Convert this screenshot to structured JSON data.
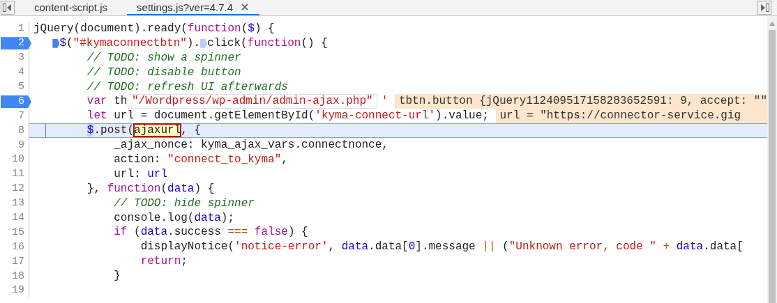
{
  "tabs": [
    {
      "label": "content-script.js",
      "selected": false
    },
    {
      "label": "settings.js?ver=4.7.4",
      "selected": true
    }
  ],
  "popover": {
    "kind": "string",
    "value": "\"/Wordpress/wp-admin/admin-ajax.php\""
  },
  "lines": [
    {
      "number": "1",
      "breakpoint": false,
      "current": false,
      "tokens": [
        {
          "kind": "plain",
          "text": "jQuery(document).ready("
        },
        {
          "kind": "keyword",
          "text": "function"
        },
        {
          "kind": "plain",
          "text": "("
        },
        {
          "kind": "variable",
          "text": "$"
        },
        {
          "kind": "plain",
          "text": ") {"
        }
      ]
    },
    {
      "number": "2",
      "breakpoint": true,
      "current": false,
      "tokens": [
        {
          "kind": "marker",
          "active": true
        },
        {
          "kind": "variable",
          "text": "$"
        },
        {
          "kind": "plain",
          "text": "("
        },
        {
          "kind": "string",
          "text": "\"#kymaconnectbtn\""
        },
        {
          "kind": "plain",
          "text": ")."
        },
        {
          "kind": "marker",
          "active": false
        },
        {
          "kind": "plain",
          "text": "click("
        },
        {
          "kind": "keyword",
          "text": "function"
        },
        {
          "kind": "plain",
          "text": "() {"
        }
      ]
    },
    {
      "number": "3",
      "breakpoint": false,
      "current": false,
      "tokens": [
        {
          "kind": "comment",
          "text": "        // TODO: show a spinner"
        }
      ]
    },
    {
      "number": "4",
      "breakpoint": false,
      "current": false,
      "tokens": [
        {
          "kind": "comment",
          "text": "        // TODO: disable button"
        }
      ]
    },
    {
      "number": "5",
      "breakpoint": false,
      "current": false,
      "tokens": [
        {
          "kind": "comment",
          "text": "        // TODO: refresh UI afterwards"
        }
      ]
    },
    {
      "number": "6",
      "breakpoint": true,
      "current": false,
      "tokens": [
        {
          "kind": "keyword",
          "text": "        var"
        },
        {
          "kind": "plain",
          "text": " th"
        }
      ],
      "after_popover": [
        {
          "kind": "string",
          "text": "'"
        }
      ],
      "inline_value": "tbtn.button {jQuery112409517158283652591: 9, accept: \"\""
    },
    {
      "number": "7",
      "breakpoint": false,
      "current": false,
      "tokens": [
        {
          "kind": "keyword",
          "text": "        let"
        },
        {
          "kind": "plain",
          "text": " url = document.getElementById("
        },
        {
          "kind": "string",
          "text": "'kyma-connect-url'"
        },
        {
          "kind": "plain",
          "text": ").value;"
        }
      ],
      "inline_value": "url = \"https://connector-service.gig"
    },
    {
      "number": "8",
      "breakpoint": false,
      "current": true,
      "tokens": [
        {
          "kind": "match",
          "text": "        $"
        },
        {
          "kind": "plain",
          "text": ".post("
        },
        {
          "kind": "hovered",
          "text": "ajaxurl"
        },
        {
          "kind": "plain",
          "text": ", {"
        }
      ]
    },
    {
      "number": "9",
      "breakpoint": false,
      "current": false,
      "tokens": [
        {
          "kind": "plain",
          "text": "            _ajax_nonce: kyma_ajax_vars.connectnonce,"
        }
      ]
    },
    {
      "number": "10",
      "breakpoint": false,
      "current": false,
      "tokens": [
        {
          "kind": "plain",
          "text": "            action: "
        },
        {
          "kind": "string",
          "text": "\"connect_to_kyma\""
        },
        {
          "kind": "plain",
          "text": ","
        }
      ]
    },
    {
      "number": "11",
      "breakpoint": false,
      "current": false,
      "tokens": [
        {
          "kind": "plain",
          "text": "            url: "
        },
        {
          "kind": "variable",
          "text": "url"
        }
      ]
    },
    {
      "number": "12",
      "breakpoint": false,
      "current": false,
      "tokens": [
        {
          "kind": "plain",
          "text": "        }, "
        },
        {
          "kind": "keyword",
          "text": "function"
        },
        {
          "kind": "plain",
          "text": "("
        },
        {
          "kind": "variable",
          "text": "data"
        },
        {
          "kind": "plain",
          "text": ") {"
        }
      ]
    },
    {
      "number": "13",
      "breakpoint": false,
      "current": false,
      "tokens": [
        {
          "kind": "comment",
          "text": "            // TODO: hide spinner"
        }
      ]
    },
    {
      "number": "14",
      "breakpoint": false,
      "current": false,
      "tokens": [
        {
          "kind": "plain",
          "text": "            console.log("
        },
        {
          "kind": "variable",
          "text": "data"
        },
        {
          "kind": "plain",
          "text": ");"
        }
      ]
    },
    {
      "number": "15",
      "breakpoint": false,
      "current": false,
      "tokens": [
        {
          "kind": "keyword",
          "text": "            if"
        },
        {
          "kind": "plain",
          "text": " ("
        },
        {
          "kind": "variable",
          "text": "data"
        },
        {
          "kind": "plain",
          "text": ".success "
        },
        {
          "kind": "operator",
          "text": "==="
        },
        {
          "kind": "keyword",
          "text": " false"
        },
        {
          "kind": "plain",
          "text": ") {"
        }
      ]
    },
    {
      "number": "16",
      "breakpoint": false,
      "current": false,
      "tokens": [
        {
          "kind": "plain",
          "text": "                displayNotice("
        },
        {
          "kind": "string",
          "text": "'notice-error'"
        },
        {
          "kind": "plain",
          "text": ", "
        },
        {
          "kind": "variable",
          "text": "data"
        },
        {
          "kind": "plain",
          "text": ".data["
        },
        {
          "kind": "number",
          "text": "0"
        },
        {
          "kind": "plain",
          "text": "].message "
        },
        {
          "kind": "operator",
          "text": "||"
        },
        {
          "kind": "plain",
          "text": " ("
        },
        {
          "kind": "string",
          "text": "\"Unknown error, code \""
        },
        {
          "kind": "operator",
          "text": " +"
        },
        {
          "kind": "variable",
          "text": " data"
        },
        {
          "kind": "plain",
          "text": ".data["
        }
      ]
    },
    {
      "number": "17",
      "breakpoint": false,
      "current": false,
      "tokens": [
        {
          "kind": "keyword",
          "text": "                return"
        },
        {
          "kind": "plain",
          "text": ";"
        }
      ]
    },
    {
      "number": "18",
      "breakpoint": false,
      "current": false,
      "tokens": [
        {
          "kind": "plain",
          "text": "            }"
        }
      ]
    },
    {
      "number": "19",
      "breakpoint": false,
      "current": false
    }
  ]
}
